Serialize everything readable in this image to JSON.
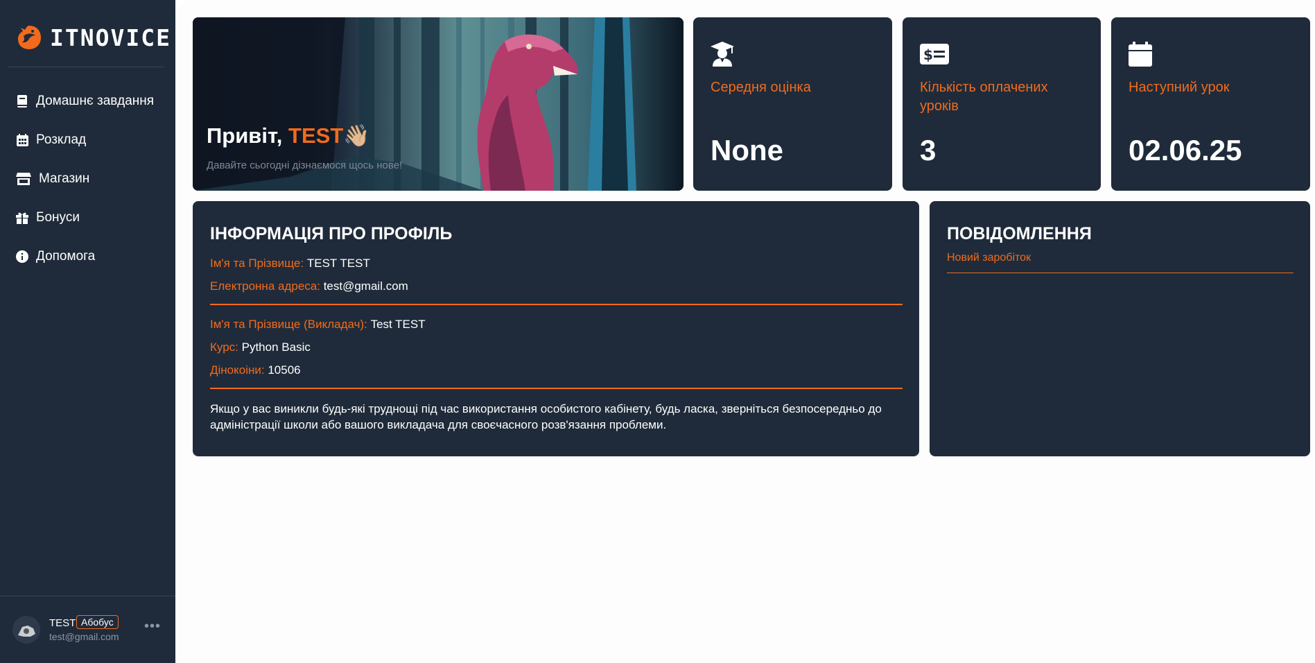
{
  "brand": {
    "name": "ITNOVICE",
    "accent": "#f26b1d"
  },
  "sidebar": {
    "bg": "#1f2b3a",
    "items": [
      {
        "label": "Домашнє завдання",
        "icon": "book-icon"
      },
      {
        "label": "Розклад",
        "icon": "calendar-grid-icon"
      },
      {
        "label": "Магазин",
        "icon": "store-icon"
      },
      {
        "label": "Бонуси",
        "icon": "gift-icon"
      },
      {
        "label": "Допомога",
        "icon": "info-icon"
      }
    ]
  },
  "user": {
    "name": "TEST",
    "badge": "Абобус",
    "email": "test@gmail.com",
    "more": "•••"
  },
  "hero": {
    "greeting": "Привіт, ",
    "name": "TEST",
    "emoji": "👋🏼",
    "subtitle": "Давайте сьогодні дізнаємося щось нове!"
  },
  "stats": [
    {
      "label": "Середня оцінка",
      "value": "None",
      "icon": "graduation-cap-icon"
    },
    {
      "label": "Кількість оплачених уроків",
      "value": "3",
      "icon": "money-bill-icon"
    },
    {
      "label": "Наступний урок",
      "value": "02.06.25",
      "icon": "calendar-icon"
    }
  ],
  "profile": {
    "title": "ІНФОРМАЦІЯ ПРО ПРОФІЛЬ",
    "name_label": "Ім'я та Прізвище:",
    "name_value": "TEST TEST",
    "email_label": "Електронна адреса:",
    "email_value": "test@gmail.com",
    "teacher_label": "Ім'я та Прізвище (Викладач):",
    "teacher_value": "Test TEST",
    "course_label": "Курс:",
    "course_value": "Python Basic",
    "coins_label": "Дінокоіни:",
    "coins_value": "10506",
    "note": "Якщо у вас виникли будь-які труднощі під час використання особистого кабінету, будь ласка, зверніться безпосередньо до адміністрації школи або вашого викладача для своєчасного розв'язання проблеми."
  },
  "notifications": {
    "title": "ПОВІДОМЛЕННЯ",
    "items": [
      "Новий заробіток"
    ]
  }
}
